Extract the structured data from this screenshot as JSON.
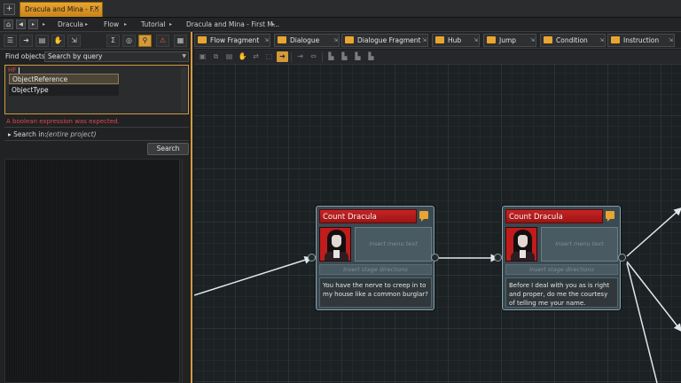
{
  "window": {
    "tab_title": "Dracula and Mina - F...",
    "close_glyph": "✕",
    "new_tab_glyph": "+"
  },
  "breadcrumbs": {
    "items": [
      "Dracula",
      "Flow",
      "Tutorial",
      "Dracula and Mina - First M..."
    ],
    "separator": "▸"
  },
  "left_panel": {
    "find_label": "Find objects:",
    "find_mode": "Search by query",
    "query_text": "HF",
    "autocomplete": [
      "ObjectReference",
      "ObjectType"
    ],
    "error": "A boolean expression was expected.",
    "search_in_label": "Search in:",
    "search_in_value": "(entire project)",
    "search_button": "Search"
  },
  "object_tabs": [
    "Flow Fragment",
    "Dialogue",
    "Dialogue Fragment",
    "Hub",
    "Jump",
    "Condition",
    "Instruction"
  ],
  "nodes": [
    {
      "speaker": "Count Dracula",
      "menu_placeholder": "Insert menu text",
      "stage_placeholder": "Insert stage directions",
      "text": "You have the nerve to creep in to my house like a common burglar?"
    },
    {
      "speaker": "Count Dracula",
      "menu_placeholder": "Insert menu text",
      "stage_placeholder": "Insert stage directions",
      "text": "Before I deal with you as is right and proper, do me the courtesy of telling me your name."
    }
  ],
  "colors": {
    "accent": "#d49a3e",
    "speaker_header": "#c62424",
    "error": "#e04848",
    "canvas": "#1c2123"
  },
  "icons": [
    "home-icon",
    "back-icon",
    "forward-icon",
    "search-icon",
    "warning-icon",
    "comment-icon"
  ]
}
